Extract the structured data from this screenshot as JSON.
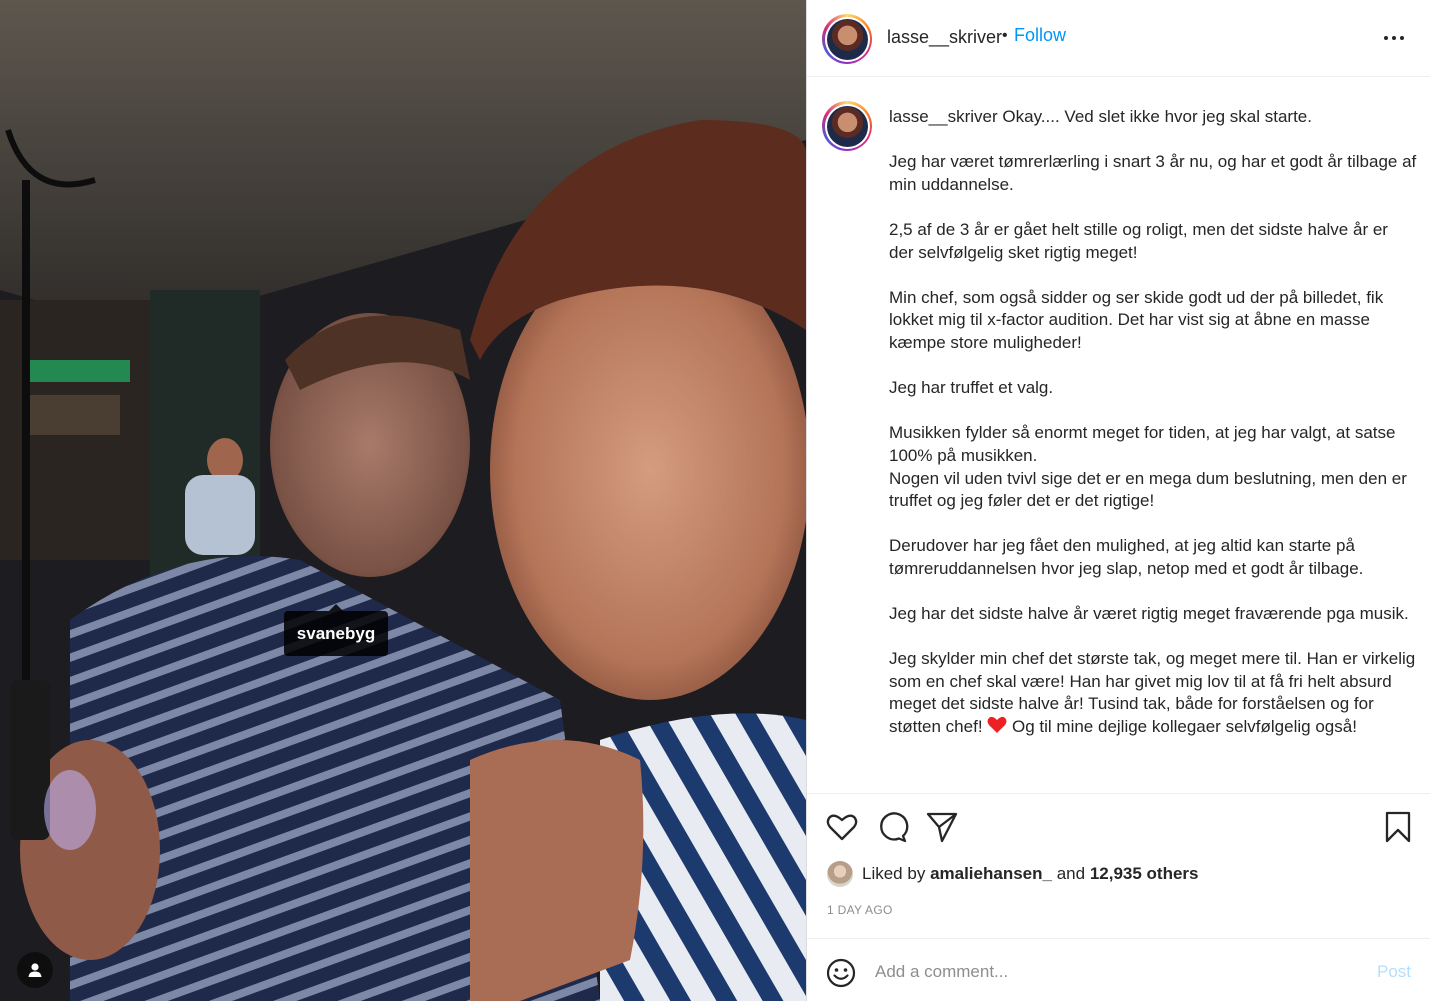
{
  "photo": {
    "tag_label": "svanebyg"
  },
  "header": {
    "username": "lasse__skriver",
    "separator": "•",
    "follow_label": "Follow"
  },
  "caption": {
    "username": "lasse__skriver",
    "first_line": "Okay.... Ved slet ikke hvor jeg skal starte.",
    "paragraphs": [
      "Jeg har været tømrerlærling i snart 3 år nu, og har et godt år tilbage af min uddannelse.",
      "2,5 af de 3 år er gået helt stille og roligt, men det sidste halve år er der selvfølgelig sket rigtig meget!",
      "Min chef, som også sidder og ser skide godt ud der på billedet, fik lokket mig til x-factor audition. Det har vist sig at åbne en masse kæmpe store muligheder!",
      "Jeg har truffet et valg.",
      "Musikken fylder så enormt meget for tiden, at jeg har valgt, at satse 100% på musikken.",
      "Nogen vil uden tvivl sige det er en mega dum beslutning, men den er truffet og jeg føler det er det rigtige!",
      "Derudover har jeg fået den mulighed, at jeg altid kan starte på tømreruddannelsen hvor jeg slap, netop med et godt år tilbage.",
      "Jeg har det sidste halve år været rigtig meget fraværende pga musik.",
      "Jeg skylder min chef det største tak, og meget mere til. Han er virkelig som en chef skal være! Han har givet mig lov til at få fri helt absurd meget det sidste halve år! Tusind tak, både for forståelsen og for støtten chef!",
      "Og til mine dejlige kollegaer selvfølgelig også!"
    ]
  },
  "actions": {
    "like_icon": "heart-outline-icon",
    "comment_icon": "comment-bubble-icon",
    "share_icon": "paper-plane-icon",
    "save_icon": "bookmark-icon"
  },
  "likes": {
    "prefix": "Liked by",
    "liker": "amaliehansen_",
    "joiner": "and",
    "others": "12,935 others"
  },
  "timeago": "1 DAY AGO",
  "comment": {
    "placeholder": "Add a comment...",
    "post_label": "Post"
  },
  "colors": {
    "link_blue": "#0095f6",
    "post_disabled": "#b2dffc",
    "heart_red": "#ed2024",
    "muted_gray": "#8e8e8e"
  }
}
